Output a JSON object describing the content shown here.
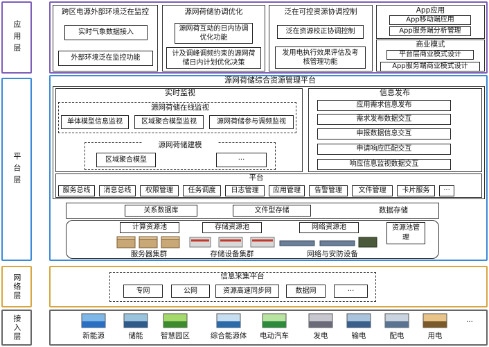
{
  "colors": {
    "app_border": "#7b5fb8",
    "platform_border": "#3b8ad8",
    "network_border": "#d8a640",
    "access_border": "#666666"
  },
  "layers": {
    "app": "应用层",
    "platform": "平台层",
    "network": "网络层",
    "access": "接入层"
  },
  "app": {
    "col1": {
      "title": "跨区电源外部环境泛在监控",
      "items": [
        "实时气象数据接入",
        "外部环境泛在监控功能"
      ]
    },
    "col2": {
      "title": "源网荷储协调优化",
      "items": [
        "源网荷互动的日内协调优化功能",
        "计及调峰调频约束的源网荷储日内计划优化决策"
      ]
    },
    "col3": {
      "title": "泛在可控资源协调控制",
      "items": [
        "泛在资源校正协调控制",
        "发用电执行效果评估及考核管理功能"
      ]
    },
    "col4a": {
      "title": "App应用",
      "items": [
        "App移动端应用",
        "App服务端分析管理"
      ]
    },
    "col4b": {
      "title": "商业模式",
      "items": [
        "平台层商业模式设计",
        "App服务端商业模式设计"
      ]
    }
  },
  "platform": {
    "title": "源网荷储综合资源管理平台",
    "monitor": {
      "title": "实时监视",
      "online_title": "源网荷储在线监视",
      "online_items": [
        "单体模型信息监视",
        "区域聚合模型监视",
        "源网荷储参与调频监视"
      ],
      "model_title": "源网荷储建模",
      "model_items": [
        "区域聚合模型",
        "···"
      ]
    },
    "publish": {
      "title": "信息发布",
      "items": [
        "应用需求信息发布",
        "需求发布数据交互",
        "申报数据信息交互",
        "申请响应匹配交互",
        "响应信息监视数据交互"
      ]
    },
    "platform_bar": {
      "title": "平台",
      "items": [
        "服务总线",
        "消息总线",
        "权限管理",
        "任务调度",
        "日志管理",
        "应用管理",
        "告警管理",
        "文件管理",
        "卡片服务",
        "···"
      ]
    },
    "storage": {
      "items": [
        "关系数据库",
        "文件型存储"
      ],
      "label": "数据存储"
    },
    "resources": {
      "compute": "计算资源池",
      "store": "存储资源池",
      "network": "网络资源池",
      "manage": "资源池管理",
      "server_label": "服务器集群",
      "storage_label": "存储设备集群",
      "network_label": "网络与安防设备"
    }
  },
  "network": {
    "title": "信息采集平台",
    "items": [
      "专网",
      "公网",
      "资源高速同步网",
      "数据网",
      "···"
    ]
  },
  "access": {
    "items": [
      "新能源",
      "储能",
      "智慧园区",
      "综合能源体",
      "电动汽车",
      "发电",
      "输电",
      "配电",
      "用电",
      "···"
    ]
  }
}
